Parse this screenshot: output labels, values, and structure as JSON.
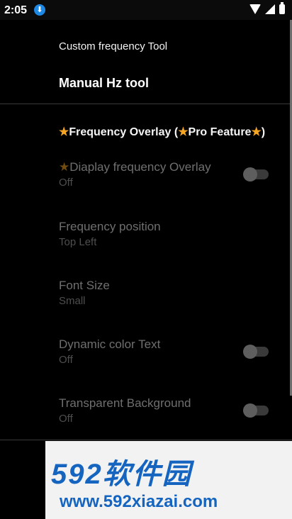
{
  "status_bar": {
    "time": "2:05"
  },
  "menu": {
    "custom_tool": "Custom frequency Tool",
    "manual_tool": "Manual Hz tool"
  },
  "overlay_section": {
    "header": "Frequency Overlay (",
    "header_pro": "Pro Feature",
    "header_end": ")"
  },
  "prefs": {
    "display_overlay": {
      "title": "Diaplay frequency Overlay",
      "summary": "Off",
      "enabled": false
    },
    "position": {
      "title": "Frequency position",
      "summary": "Top Left"
    },
    "font_size": {
      "title": "Font Size",
      "summary": "Small"
    },
    "dynamic_color": {
      "title": "Dynamic color Text",
      "summary": "Off",
      "enabled": false
    },
    "transparent_bg": {
      "title": "Transparent Background",
      "summary": "Off",
      "enabled": false
    }
  },
  "watermark": {
    "top": "592软件园",
    "bottom": "www.592xiazai.com"
  },
  "icons": [
    "download-icon",
    "wifi-icon",
    "signal-icon",
    "battery-icon",
    "star-icon"
  ],
  "colors": {
    "accent_star": "#f6a623",
    "watermark_blue": "#1565c0"
  }
}
